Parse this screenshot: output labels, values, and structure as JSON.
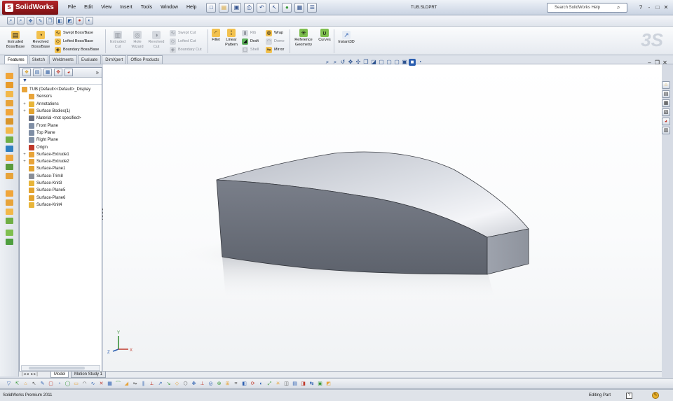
{
  "app": {
    "brand": "SolidWorks",
    "document_title": "TUB.SLDPRT",
    "search_placeholder": "Search SolidWorks Help",
    "title_right_icons": [
      "?",
      "-",
      "□",
      "✕"
    ]
  },
  "menu": [
    "File",
    "Edit",
    "View",
    "Insert",
    "Tools",
    "Window",
    "Help"
  ],
  "command_manager": {
    "extruded_boss": "Extruded Boss/Base",
    "revolved_boss": "Revolved Boss/Base",
    "swept_boss": "Swept Boss/Base",
    "lofted_boss": "Lofted Boss/Base",
    "boundary_boss": "Boundary Boss/Base",
    "extruded_cut": "Extruded Cut",
    "hole_wizard": "Hole Wizard",
    "revolved_cut": "Revolved Cut",
    "swept_cut": "Swept Cut",
    "lofted_cut": "Lofted Cut",
    "boundary_cut": "Boundary Cut",
    "fillet": "Fillet",
    "linear_pattern": "Linear Pattern",
    "rib": "Rib",
    "draft": "Draft",
    "shell": "Shell",
    "wrap": "Wrap",
    "dome": "Dome",
    "mirror": "Mirror",
    "reference_geometry": "Reference Geometry",
    "curves": "Curves",
    "instant3d": "Instant3D"
  },
  "tabs": [
    "Features",
    "Sketch",
    "Weldments",
    "Evaluate",
    "DimXpert",
    "Office Products"
  ],
  "feature_tree": {
    "root": "TUB  (Default<<Default>_Display",
    "items": [
      {
        "label": "Sensors",
        "expand": "",
        "icon": "sensor-icon",
        "color": "#e8a43a"
      },
      {
        "label": "Annotations",
        "expand": "+",
        "icon": "annotations-icon",
        "color": "#e8b53a"
      },
      {
        "label": "Surface Bodies(1)",
        "expand": "+",
        "icon": "surface-bodies-icon",
        "color": "#e3a430"
      },
      {
        "label": "Material <not specified>",
        "expand": "",
        "icon": "material-icon",
        "color": "#6a7080"
      },
      {
        "label": "Front Plane",
        "expand": "",
        "icon": "plane-icon",
        "color": "#7f8ea5"
      },
      {
        "label": "Top Plane",
        "expand": "",
        "icon": "plane-icon",
        "color": "#7f8ea5"
      },
      {
        "label": "Right Plane",
        "expand": "",
        "icon": "plane-icon",
        "color": "#7f8ea5"
      },
      {
        "label": "Origin",
        "expand": "",
        "icon": "origin-icon",
        "color": "#c0392b"
      },
      {
        "label": "Surface-Extrude1",
        "expand": "+",
        "icon": "surface-extrude-icon",
        "color": "#e8a43a"
      },
      {
        "label": "Surface-Extrude2",
        "expand": "+",
        "icon": "surface-extrude-icon",
        "color": "#e8a43a"
      },
      {
        "label": "Surface-Plane1",
        "expand": "",
        "icon": "surface-plane-icon",
        "color": "#e3a430"
      },
      {
        "label": "Surface-Trim8",
        "expand": "",
        "icon": "surface-trim-icon",
        "color": "#8a8f98"
      },
      {
        "label": "Surface-Knit3",
        "expand": "",
        "icon": "surface-knit-icon",
        "color": "#e8b53a"
      },
      {
        "label": "Surface-Plane5",
        "expand": "",
        "icon": "surface-plane-icon",
        "color": "#e3a430"
      },
      {
        "label": "Surface-Plane6",
        "expand": "",
        "icon": "surface-plane-icon",
        "color": "#e3a430"
      },
      {
        "label": "Surface-Knit4",
        "expand": "",
        "icon": "surface-knit-icon",
        "color": "#e8b53a"
      }
    ]
  },
  "model_tabs": [
    "Model",
    "Motion Study 1"
  ],
  "status": {
    "product": "SolidWorks Premium 2011",
    "mode": "Editing Part",
    "help": "?"
  },
  "triad": {
    "x": "X",
    "y": "Y",
    "z": "Z"
  },
  "colors": {
    "accent_blue": "#2c5fb0",
    "brand_red": "#b3262a",
    "feature_orange": "#e8a43a",
    "part_gray": "#7d838d"
  }
}
